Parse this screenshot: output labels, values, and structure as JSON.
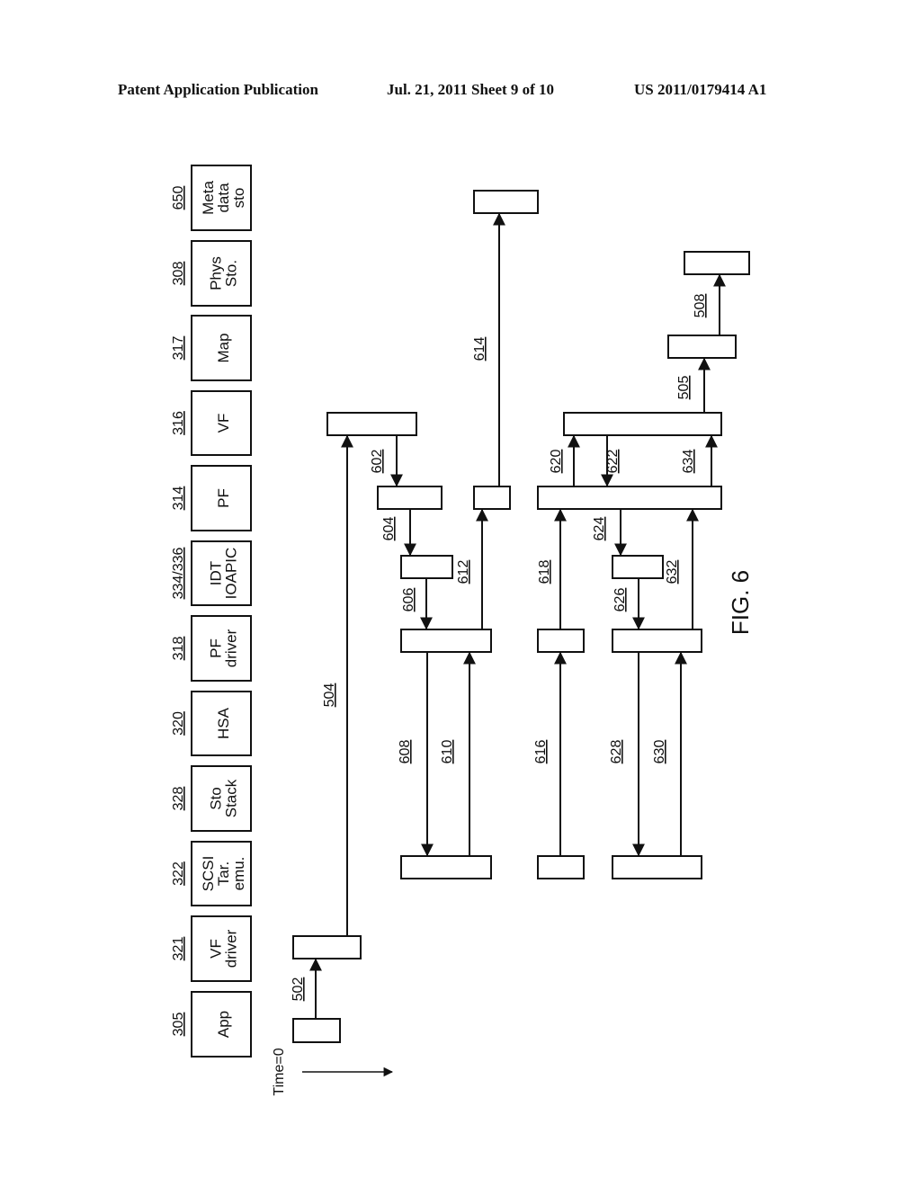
{
  "header": {
    "publication": "Patent Application Publication",
    "date_sheet": "Jul. 21, 2011   Sheet 9 of 10",
    "patent_number": "US 2011/0179414 A1"
  },
  "figure": {
    "caption": "FIG. 6",
    "time_label": "Time=0",
    "lanes": [
      {
        "ref": "305",
        "label": [
          "App"
        ]
      },
      {
        "ref": "321",
        "label": [
          "VF",
          "driver"
        ]
      },
      {
        "ref": "322",
        "label": [
          "SCSI",
          "Tar.",
          "emu."
        ]
      },
      {
        "ref": "328",
        "label": [
          "Sto",
          "Stack"
        ]
      },
      {
        "ref": "320",
        "label": [
          "HSA"
        ]
      },
      {
        "ref": "318",
        "label": [
          "PF",
          "driver"
        ]
      },
      {
        "ref": "334/336",
        "label": [
          "IDT",
          "IOAPIC"
        ]
      },
      {
        "ref": "314",
        "label": [
          "PF"
        ]
      },
      {
        "ref": "316",
        "label": [
          "VF"
        ]
      },
      {
        "ref": "317",
        "label": [
          "Map"
        ]
      },
      {
        "ref": "308",
        "label": [
          "Phys",
          "Sto."
        ]
      },
      {
        "ref": "650",
        "label": [
          "Meta",
          "data",
          "sto"
        ]
      }
    ],
    "arrows": [
      {
        "ref": "502",
        "from": "App",
        "to": "VF driver"
      },
      {
        "ref": "504",
        "from": "VF driver",
        "to": "VF"
      },
      {
        "ref": "602",
        "from": "VF",
        "to": "PF"
      },
      {
        "ref": "604",
        "from": "PF",
        "to": "IDT/IOAPIC"
      },
      {
        "ref": "606",
        "from": "IDT/IOAPIC",
        "to": "PF driver"
      },
      {
        "ref": "608",
        "from": "PF driver",
        "to": "SCSI Tar. emu."
      },
      {
        "ref": "610",
        "from": "SCSI Tar. emu.",
        "to": "PF driver"
      },
      {
        "ref": "612",
        "from": "PF driver",
        "to": "PF"
      },
      {
        "ref": "614",
        "from": "PF",
        "to": "Meta data sto"
      },
      {
        "ref": "616",
        "from": "SCSI Tar. emu.",
        "to": "PF driver"
      },
      {
        "ref": "618",
        "from": "PF driver",
        "to": "PF"
      },
      {
        "ref": "620",
        "from": "PF",
        "to": "VF"
      },
      {
        "ref": "622",
        "from": "VF",
        "to": "PF"
      },
      {
        "ref": "624",
        "from": "PF",
        "to": "IDT/IOAPIC"
      },
      {
        "ref": "626",
        "from": "IDT/IOAPIC",
        "to": "PF driver"
      },
      {
        "ref": "628",
        "from": "PF driver",
        "to": "SCSI Tar. emu."
      },
      {
        "ref": "630",
        "from": "SCSI Tar. emu.",
        "to": "PF driver"
      },
      {
        "ref": "632",
        "from": "PF driver",
        "to": "PF"
      },
      {
        "ref": "634",
        "from": "PF",
        "to": "VF"
      },
      {
        "ref": "505",
        "from": "VF",
        "to": "Map"
      },
      {
        "ref": "508",
        "from": "Map",
        "to": "Phys Sto."
      }
    ]
  }
}
